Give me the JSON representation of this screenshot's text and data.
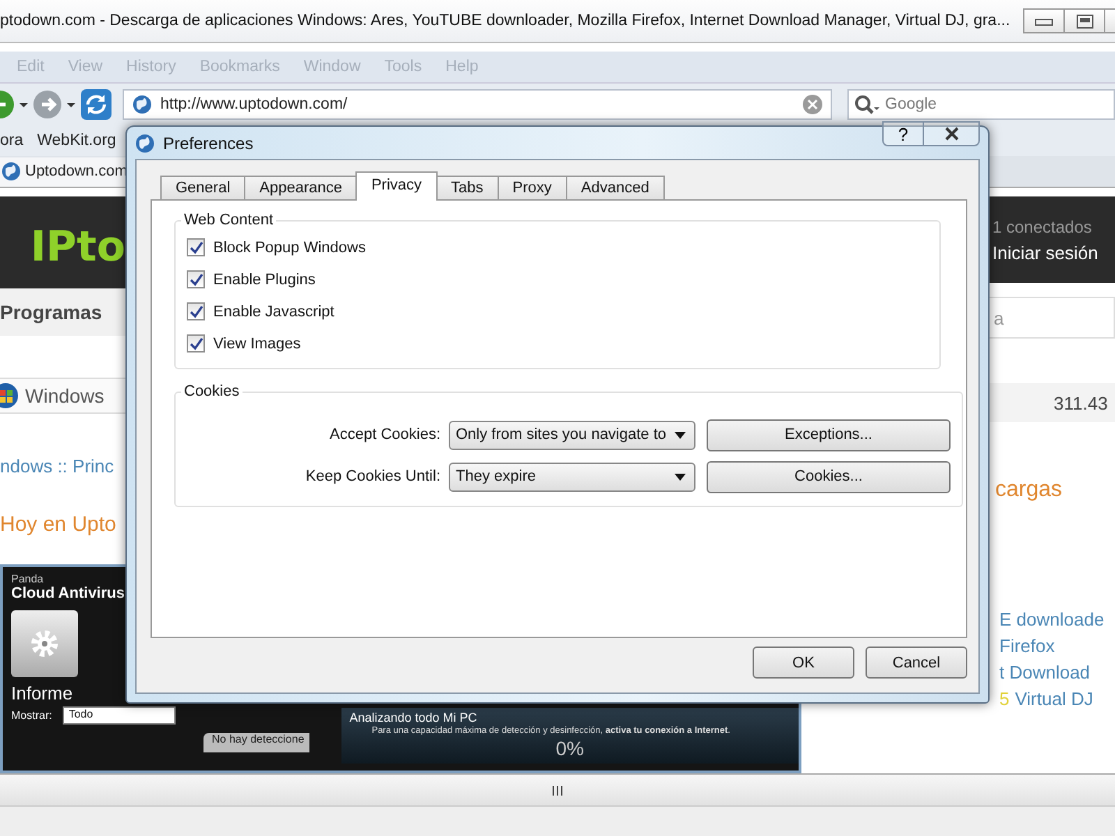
{
  "window": {
    "title": "ptodown.com - Descarga de aplicaciones Windows: Ares, YouTUBE downloader, Mozilla Firefox, Internet Download Manager, Virtual DJ, gra..."
  },
  "menu": [
    {
      "label": "Edit",
      "disabled": true
    },
    {
      "label": "View",
      "disabled": true
    },
    {
      "label": "History",
      "disabled": true
    },
    {
      "label": "Bookmarks",
      "disabled": true
    },
    {
      "label": "Window",
      "disabled": true
    },
    {
      "label": "Tools",
      "disabled": true
    },
    {
      "label": "Help",
      "disabled": true
    }
  ],
  "toolbar": {
    "url": "http://www.uptodown.com/",
    "search_placeholder": "Google"
  },
  "bookmarks": [
    "ora",
    "WebKit.org"
  ],
  "page_tab": {
    "label": "Uptodown.com"
  },
  "page": {
    "logo": "IPto",
    "online": "1 conectados",
    "login": "Iniciar sesión",
    "nav": "Programas",
    "search_value": "a",
    "section": "Windows",
    "count": "311.43",
    "breadcrumb": "ndows :: Princ",
    "heading_left": "Hoy en Upto",
    "heading_right": "cargas",
    "downloads": [
      {
        "text": "E downloade"
      },
      {
        "text": "Firefox"
      },
      {
        "text": "t Download"
      },
      {
        "number": "5",
        "text": "Virtual DJ"
      }
    ]
  },
  "panda": {
    "brand": "Panda",
    "product": "Cloud Antivirus",
    "section": "Informe",
    "filter_label": "Mostrar:",
    "filter_value": "Todo",
    "empty": "No hay deteccione",
    "scan_title": "Analizando todo Mi PC",
    "scan_note": "Para una capacidad máxima de detección y desinfección, **activa tu conexión a Internet**.",
    "progress": "0%"
  },
  "dialog": {
    "title": "Preferences",
    "help": "?",
    "tabs": [
      {
        "label": "General",
        "selected": false
      },
      {
        "label": "Appearance",
        "selected": false
      },
      {
        "label": "Privacy",
        "selected": true
      },
      {
        "label": "Tabs",
        "selected": false
      },
      {
        "label": "Proxy",
        "selected": false
      },
      {
        "label": "Advanced",
        "selected": false
      }
    ],
    "web_content": {
      "title": "Web Content",
      "options": [
        {
          "label": "Block Popup Windows",
          "checked": true
        },
        {
          "label": "Enable Plugins",
          "checked": true
        },
        {
          "label": "Enable Javascript",
          "checked": true
        },
        {
          "label": "View Images",
          "checked": true
        }
      ]
    },
    "cookies": {
      "title": "Cookies",
      "rows": [
        {
          "label": "Accept Cookies:",
          "value": "Only from sites you navigate to",
          "button": "Exceptions..."
        },
        {
          "label": "Keep Cookies Until:",
          "value": "They expire",
          "button": "Cookies..."
        }
      ]
    },
    "buttons": [
      "OK",
      "Cancel"
    ]
  }
}
